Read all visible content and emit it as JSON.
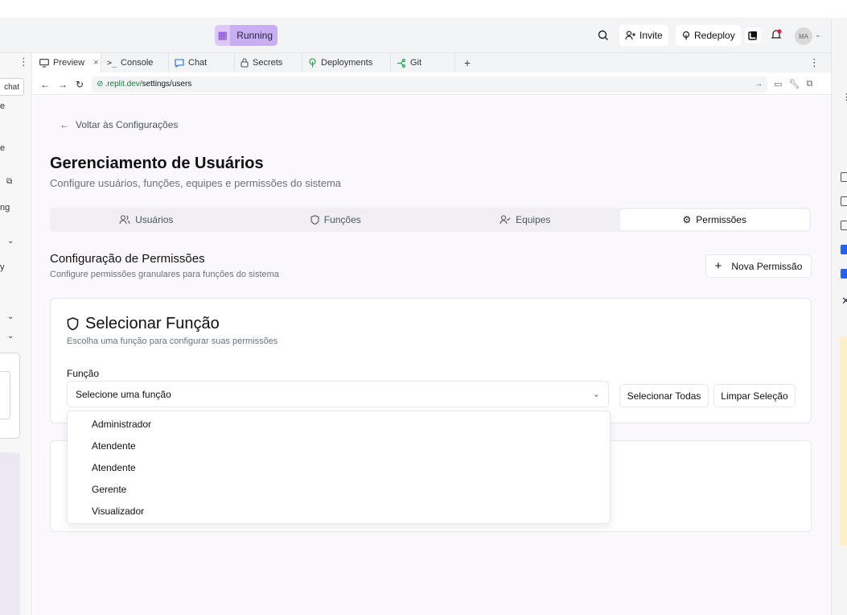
{
  "topbar": {
    "running_label": "Running",
    "invite_label": "Invite",
    "redeploy_label": "Redeploy",
    "avatar_initials": "MA"
  },
  "left_panel": {
    "chat_label": "chat",
    "snippets": [
      "e",
      "e",
      "ng",
      "y"
    ]
  },
  "tabs": [
    {
      "label": "Preview",
      "icon": "monitor-icon",
      "closable": true
    },
    {
      "label": "Console",
      "icon": "terminal-icon"
    },
    {
      "label": "Chat",
      "icon": "chat-bubble-icon"
    },
    {
      "label": "Secrets",
      "icon": "lock-icon"
    },
    {
      "label": "Deployments",
      "icon": "deploy-icon"
    },
    {
      "label": "Git",
      "icon": "git-icon"
    }
  ],
  "url": {
    "domain": ".replit.dev/",
    "path": "settings/users"
  },
  "page": {
    "back_label": "Voltar às Configurações",
    "title": "Gerenciamento de Usuários",
    "subtitle": "Configure usuários, funções, equipes e permissões do sistema",
    "section_tabs": [
      {
        "label": "Usuários",
        "icon": "users-icon"
      },
      {
        "label": "Funções",
        "icon": "shield-icon"
      },
      {
        "label": "Equipes",
        "icon": "user-check-icon"
      },
      {
        "label": "Permissões",
        "icon": "gear-icon",
        "active": true
      }
    ],
    "section_title": "Configuração de Permissões",
    "section_subtitle": "Configure permissões granulares para funções do sistema",
    "new_button": "Nova Permissão",
    "card": {
      "title": "Selecionar Função",
      "subtitle": "Escolha uma função para configurar suas permissões",
      "field_label": "Função",
      "select_placeholder": "Selecione uma função",
      "select_all": "Selecionar Todas",
      "clear_selection": "Limpar Seleção"
    },
    "dropdown_options": [
      "Administrador",
      "Atendente",
      "Atendente",
      "Gerente",
      "Visualizador"
    ]
  },
  "colors": {
    "accent": "#c9aef4",
    "page_bg": "#faf8fd",
    "link_green": "#15803d"
  }
}
